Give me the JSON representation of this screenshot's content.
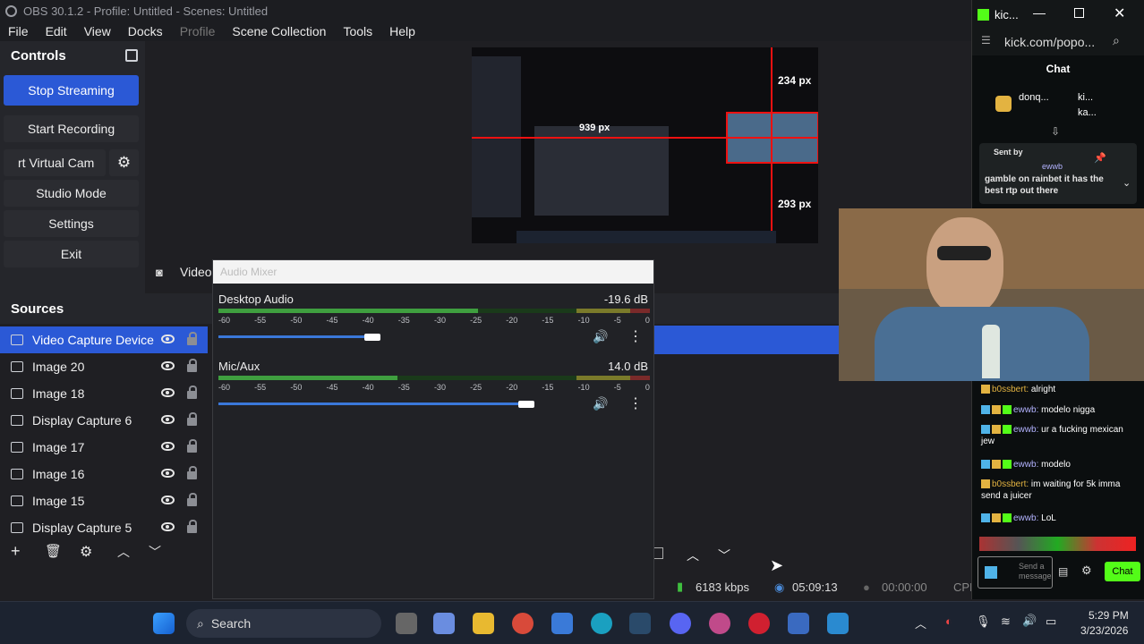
{
  "window": {
    "title": "OBS 30.1.2 - Profile: Untitled - Scenes: Untitled"
  },
  "menu": [
    "File",
    "Edit",
    "View",
    "Docks",
    "Profile",
    "Scene Collection",
    "Tools",
    "Help"
  ],
  "controls": {
    "title": "Controls",
    "stop_streaming": "Stop Streaming",
    "start_recording": "Start Recording",
    "virtual_cam": "rt Virtual Cam",
    "studio_mode": "Studio Mode",
    "settings": "Settings",
    "exit": "Exit"
  },
  "preview": {
    "label_width": "939 px",
    "label_top": "234 px",
    "label_bottom": "293 px"
  },
  "video_label": "Video",
  "sources": {
    "title": "Sources",
    "items": [
      {
        "label": "Video Capture Device",
        "type": "camera-icon",
        "selected": true
      },
      {
        "label": "Image 20",
        "type": "image-icon"
      },
      {
        "label": "Image 18",
        "type": "image-icon"
      },
      {
        "label": "Display Capture 6",
        "type": "monitor-icon"
      },
      {
        "label": "Image 17",
        "type": "image-icon"
      },
      {
        "label": "Image 16",
        "type": "image-icon"
      },
      {
        "label": "Image 15",
        "type": "image-icon"
      },
      {
        "label": "Display Capture 5",
        "type": "monitor-icon"
      }
    ]
  },
  "mixer": {
    "title": "Audio Mixer",
    "ticks": [
      "-60",
      "-55",
      "-50",
      "-45",
      "-40",
      "-35",
      "-30",
      "-25",
      "-20",
      "-15",
      "-10",
      "-5",
      "0"
    ],
    "channels": [
      {
        "name": "Desktop Audio",
        "db": "-19.6 dB",
        "volume_fraction": 0.42
      },
      {
        "name": "Mic/Aux",
        "db": "14.0 dB",
        "volume_fraction": 0.84
      }
    ]
  },
  "status": {
    "bitrate": "6183 kbps",
    "stream_time": "05:09:13",
    "rec_time": "00:00:00",
    "cpu": "CPI"
  },
  "chat": {
    "title": "kic...",
    "url": "kick.com/popo...",
    "header": "Chat",
    "top_users": [
      "donq...",
      "ki...",
      "ka..."
    ],
    "pinned_label": "Sent by",
    "pinned_user": "ewwb",
    "pinned_text": "gamble on rainbet it has the best rtp out there",
    "messages": [
      {
        "user": "b0ssbert:",
        "text": "alright",
        "gold": true
      },
      {
        "user": "ewwb:",
        "text": "modelo nigga",
        "gold": false
      },
      {
        "user": "ewwb:",
        "text": "ur a fucking mexican jew",
        "gold": false
      },
      {
        "user": "ewwb:",
        "text": "modelo",
        "gold": false
      },
      {
        "user": "b0ssbert:",
        "text": "im waiting for 5k imma send a juicer",
        "gold": true
      },
      {
        "user": "ewwb:",
        "text": "LoL",
        "gold": false
      }
    ],
    "send_placeholder": "Send a message",
    "chat_button": "Chat"
  },
  "taskbar": {
    "search": "Search",
    "time": "5:29 PM",
    "date": "3/23/2026"
  },
  "colors": {
    "accent": "#2b59d6",
    "kick_green": "#53fc18"
  }
}
